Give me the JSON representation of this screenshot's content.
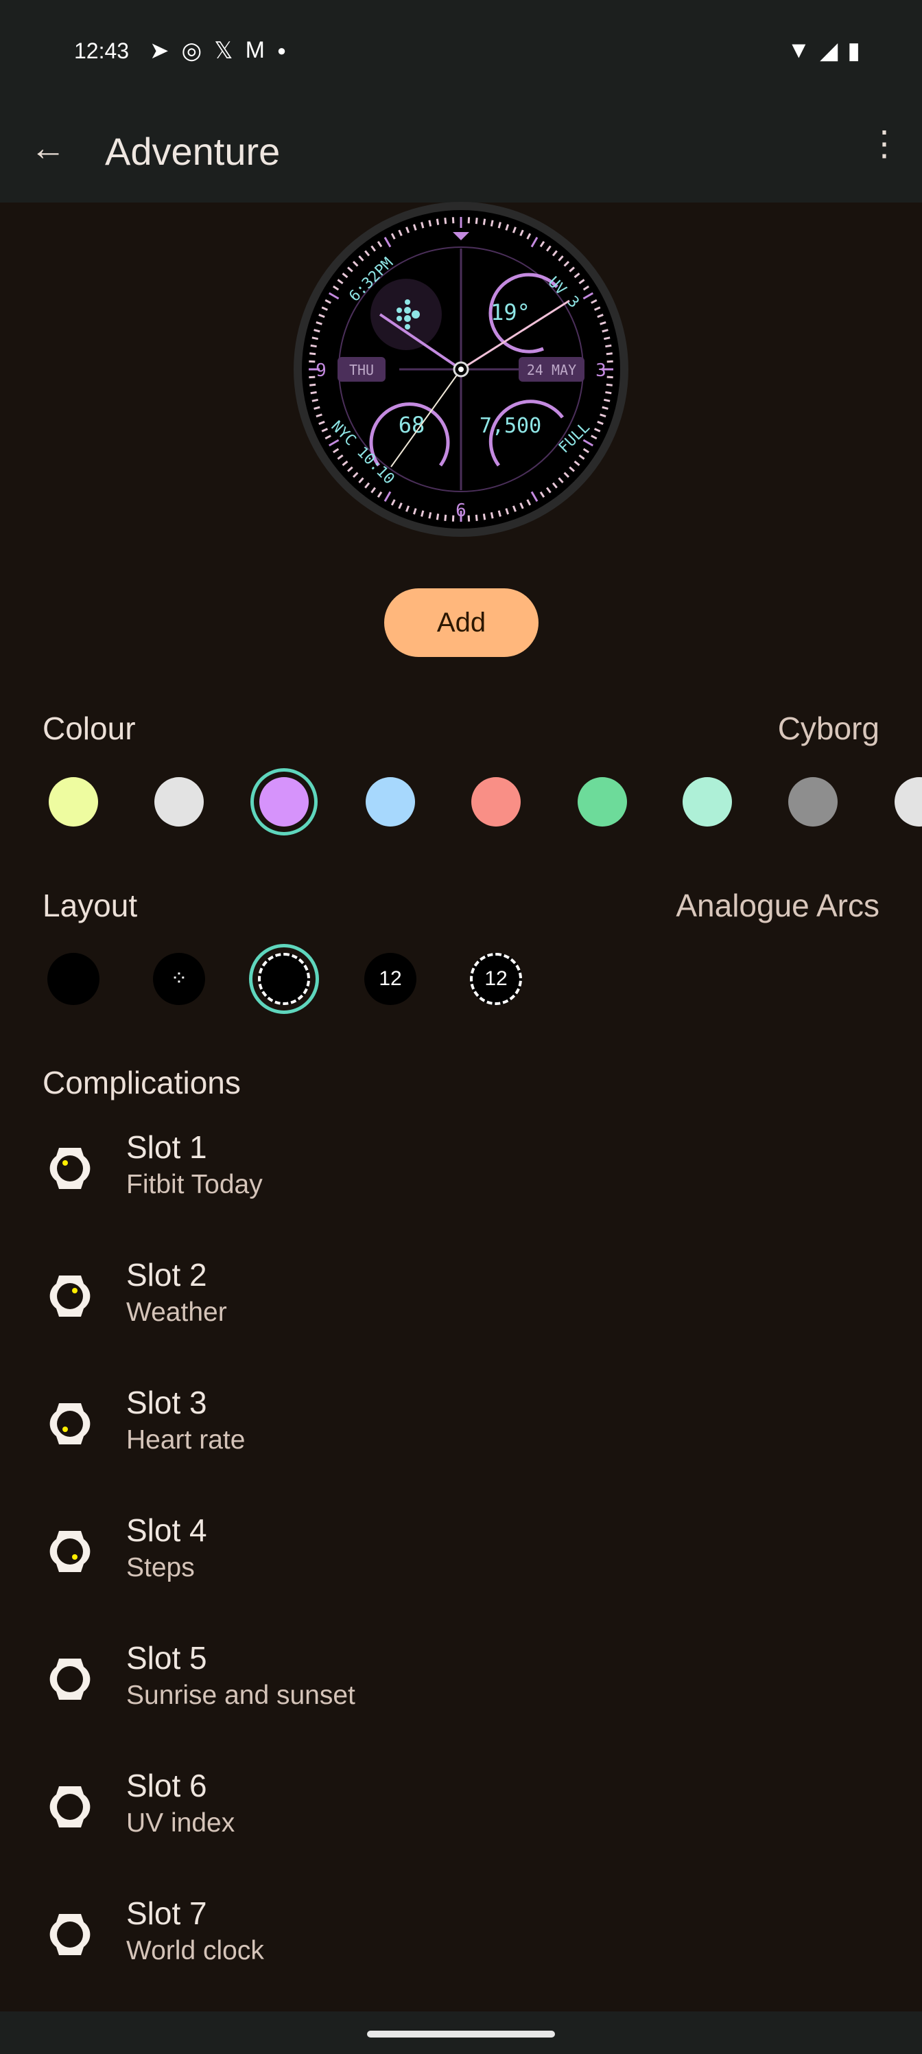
{
  "status": {
    "time": "12:43",
    "notif_icons": [
      "telegram-icon",
      "whatsapp-icon",
      "x-icon",
      "gmail-icon",
      "dot-icon"
    ],
    "right_icons": [
      "wifi-icon",
      "signal-icon",
      "battery-charging-icon"
    ]
  },
  "appbar": {
    "title": "Adventure"
  },
  "watch": {
    "sunset": "6:32PM",
    "uv": "UV 3",
    "day": "THU",
    "date": "24 MAY",
    "weather": "19°",
    "heart": "68",
    "steps": "7,500",
    "world": "NYC 10:10",
    "battery": "FULL",
    "n9": "9",
    "n3": "3",
    "n6": "6"
  },
  "add_label": "Add",
  "colour": {
    "label": "Colour",
    "value": "Cyborg",
    "swatches": [
      "#eefca0",
      "#e3e3e3",
      "#d693fb",
      "#a7d8fd",
      "#f98f86",
      "#6ddb9a",
      "#aef0d7",
      "#8e8e8e",
      "#e3e3e3"
    ],
    "selected": 2
  },
  "layout": {
    "label": "Layout",
    "value": "Analogue Arcs",
    "selected": 2
  },
  "complications": {
    "label": "Complications",
    "slots": [
      {
        "title": "Slot 1",
        "value": "Fitbit Today"
      },
      {
        "title": "Slot 2",
        "value": "Weather"
      },
      {
        "title": "Slot 3",
        "value": "Heart rate"
      },
      {
        "title": "Slot 4",
        "value": "Steps"
      },
      {
        "title": "Slot 5",
        "value": "Sunrise and sunset"
      },
      {
        "title": "Slot 6",
        "value": "UV index"
      },
      {
        "title": "Slot 7",
        "value": "World clock"
      }
    ]
  }
}
